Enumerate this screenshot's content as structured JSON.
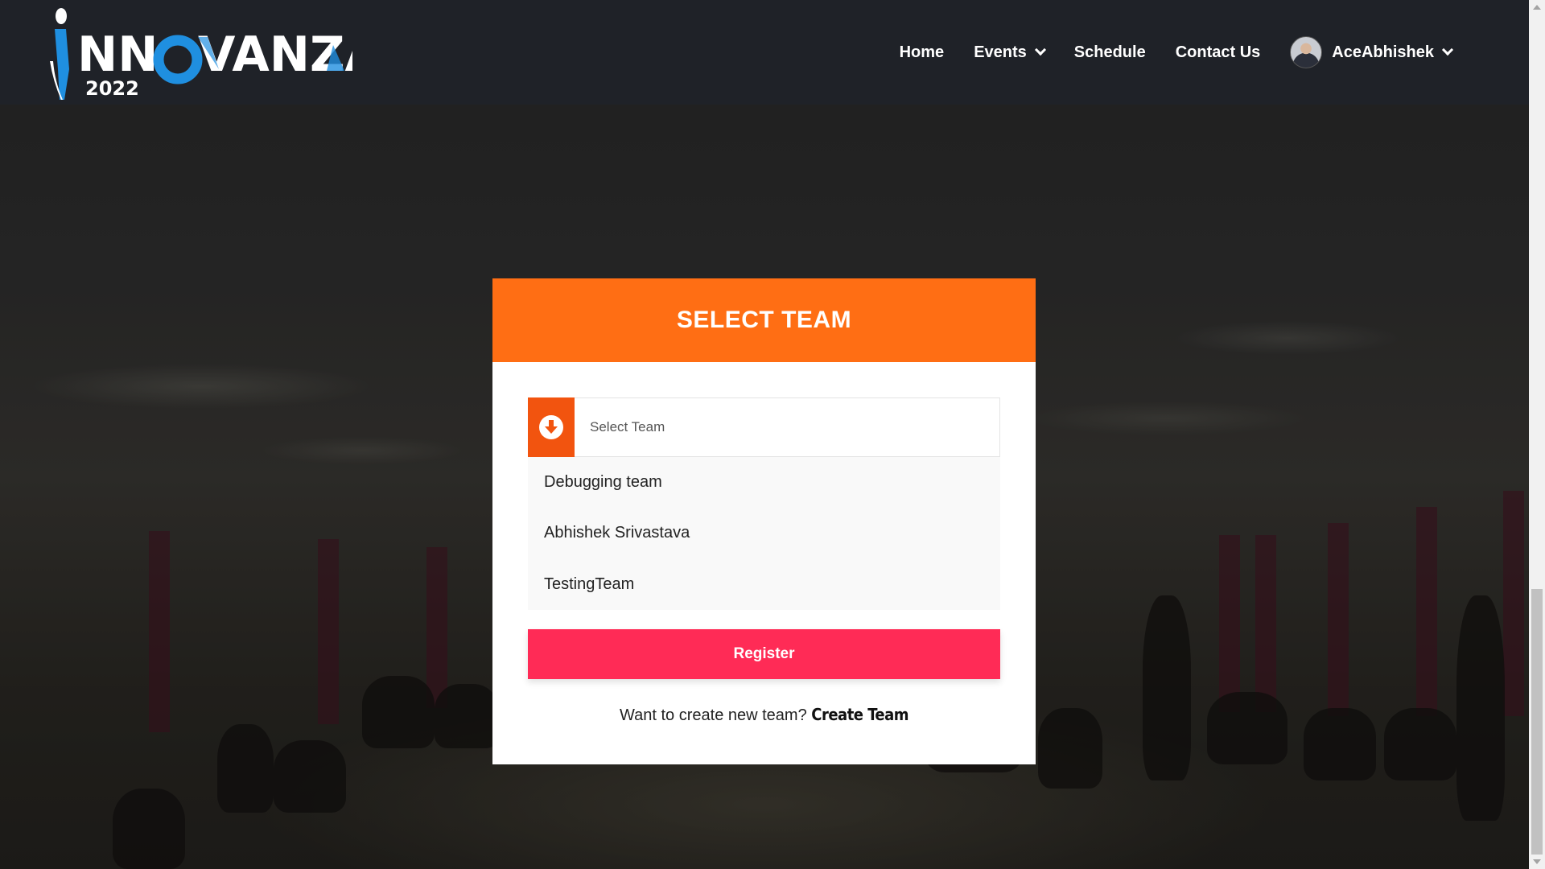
{
  "brand": {
    "logo_text": "NNOVANZA",
    "logo_year": "2022",
    "colors": {
      "blue": "#1f8fe0",
      "white": "#ffffff"
    }
  },
  "nav": {
    "items": [
      {
        "label": "Home",
        "dropdown": false
      },
      {
        "label": "Events",
        "dropdown": true
      },
      {
        "label": "Schedule",
        "dropdown": false
      },
      {
        "label": "Contact Us",
        "dropdown": false
      }
    ],
    "user": {
      "name": "AceAbhishek",
      "dropdown": true
    }
  },
  "card": {
    "title": "SELECT TEAM",
    "select": {
      "icon": "arrow-down-circle-icon",
      "placeholder": "Select Team"
    },
    "options": [
      {
        "label": "Debugging team"
      },
      {
        "label": "Abhishek Srivastava"
      },
      {
        "label": "TestingTeam"
      }
    ],
    "register_label": "Register",
    "create_prompt": "Want to create new team?",
    "create_link": "Create Team"
  },
  "colors": {
    "header_orange": "#ff6e14",
    "icon_orange": "#f2540f",
    "register_pink": "#ff2b56",
    "navbar_bg": "#1f2228"
  }
}
